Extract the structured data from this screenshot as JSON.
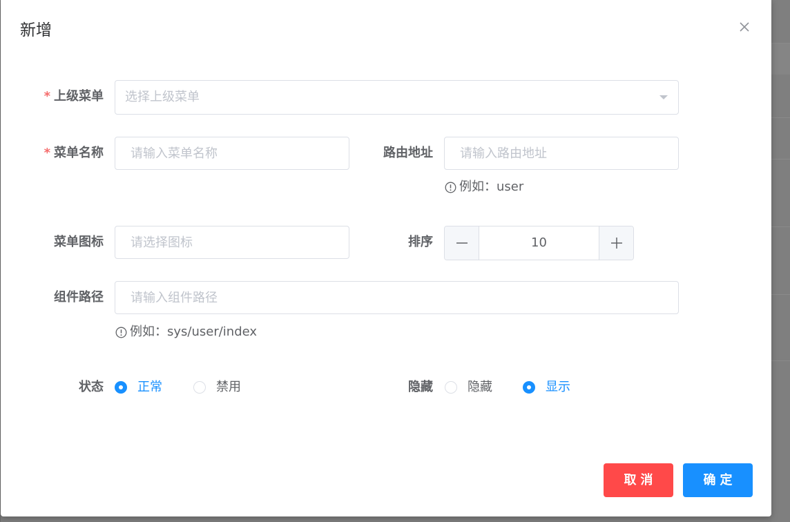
{
  "dialog": {
    "title": "新增"
  },
  "form": {
    "parent_menu": {
      "label": "上级菜单",
      "required_mark": "*",
      "placeholder": "选择上级菜单"
    },
    "menu_name": {
      "label": "菜单名称",
      "required_mark": "*",
      "placeholder": "请输入菜单名称"
    },
    "route": {
      "label": "路由地址",
      "placeholder": "请输入路由地址",
      "hint": "例如：user"
    },
    "menu_icon": {
      "label": "菜单图标",
      "placeholder": "请选择图标"
    },
    "sort": {
      "label": "排序",
      "value": "10"
    },
    "component": {
      "label": "组件路径",
      "placeholder": "请输入组件路径",
      "hint": "例如：sys/user/index"
    },
    "status": {
      "label": "状态",
      "options": [
        "正常",
        "禁用"
      ],
      "selected": "正常"
    },
    "hidden": {
      "label": "隐藏",
      "options": [
        "隐藏",
        "显示"
      ],
      "selected": "显示"
    }
  },
  "footer": {
    "cancel_label": "取消",
    "ok_label": "确定"
  },
  "colors": {
    "primary": "#1890ff",
    "danger": "#ff4949",
    "required": "#f56c6c"
  }
}
